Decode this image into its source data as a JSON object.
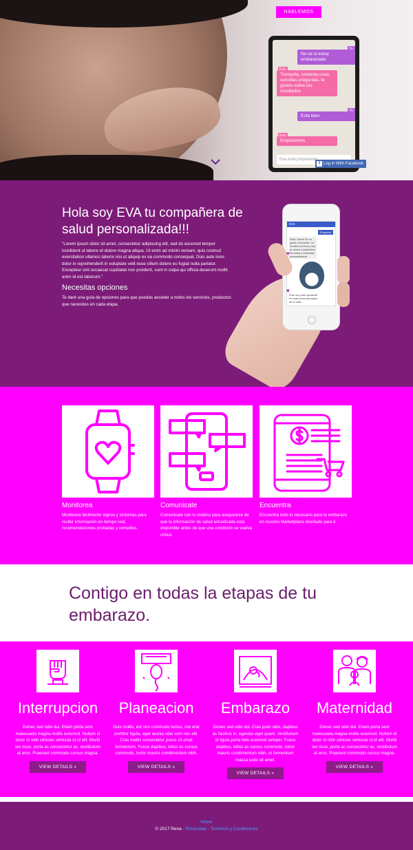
{
  "hero": {
    "cta_label": "HABLEMOS",
    "chat": {
      "messages": [
        {
          "who": "Yo:",
          "text": "No se si estoy embarazada"
        },
        {
          "who": "Eva:",
          "text": "Tranquila, contesta unas sencillas preguntas, te guiare sobre tus resultados"
        },
        {
          "who": "Yo:",
          "text": "Esta bien"
        },
        {
          "who": "Eva:",
          "text": "Empecemos"
        }
      ],
      "input_placeholder": "Eva está preparando...",
      "fb_label": "Log in With Facebook"
    }
  },
  "intro": {
    "title": "Hola soy EVA tu compañera de salud personalizada!!!",
    "lorem": "\"Lorem ipsum dolor sit amet, consectetur adipiscing elit, sed do eiusmod tempor incididunt ut labore et dolore magna aliqua. Ut enim ad minim veniam, quis nostrud exercitation ullamco laboris nisi ut aliquip ex ea commodo consequat. Duis aute irure dolor in reprehenderit in voluptate velit esse cillum dolore eu fugiat nulla pariatur. Excepteur sint occaecat cupidatat non proident, sunt in culpa qui officia deserunt mollit anim id est laborum.\"",
    "subtitle": "Necesitas opciones",
    "options_text": "Te daré una guía de opciones para que puedas acceder a todos los servicios, productos que necesites en cada etapa.",
    "phone": {
      "app_name": "EVA",
      "bubble1": "Empezar",
      "bubble2": "Hola, Karla! Es un gusto conocerla, mi nombre es Eva y soy tu nueva compañera de salud y bienestar personalizada.",
      "bubble3": "Esto soy para ayudarte en esta hermosa etapa de tu vida..."
    }
  },
  "features": [
    {
      "title": "Monitorea",
      "text": "Monitorea fácilmente signos y síntomas para recibir información en tiempo real, recomendaciones probadas y remedios.",
      "icon": "smartwatch-heart-icon"
    },
    {
      "title": "Comunicate",
      "text": "Comunicate con tu médico para asegurarse de que la información de salud actualizada está disponible antes de que una condición se vuelva crítica",
      "icon": "phone-chat-icon"
    },
    {
      "title": "Encuentra",
      "text": "Encuentra todo lo necesario para tu embarazo en nuestro Marketplace diseñado para ti.",
      "icon": "tablet-cart-icon"
    }
  ],
  "contigo": {
    "title": "Contigo en todas la etapas de tu embarazo."
  },
  "stages": [
    {
      "title": "Interrupcion",
      "text": "Donec sed odio dui. Etiam porta sem malesuada magna mollis euismod. Nullam id dolor id nibh ultricies vehicula ut id elit. Morbi leo risus, porta ac consectetur ac, vestibulum at eros. Praesent commodo cursus magna.",
      "button": "VIEW DETAILS »",
      "icon": "raised-fist-icon"
    },
    {
      "title": "Planeacion",
      "text": "Duis mollis, est non commodo luctus, nisi erat porttitor ligula, eget lacinia odio sem nec elit. Cras mattis consectetur purus sit amet fermentum. Fusce dapibus, tellus ac cursus commodo, tortor mauris condimentum nibh.",
      "button": "VIEW DETAILS »",
      "icon": "calendar-balloon-icon"
    },
    {
      "title": "Embarazo",
      "text": "Donec sed odio dui. Cras justo odio, dapibus ac facilisis in, egestas eget quam. Vestibulum id ligula porta felis euismod semper. Fusce dapibus, tellus ac cursus commodo, tortor mauris condimentum nibh, ut fermentum massa justo sit amet.",
      "button": "VIEW DETAILS »",
      "icon": "ultrasound-icon"
    },
    {
      "title": "Maternidad",
      "text": "Donec sed odio dui. Etiam porta sem malesuada magna mollis euismod. Nullam id dolor id nibh ultricies vehicula ut id elit. Morbi leo risus, porta ac consectetur ac, vestibulum at eros. Praesent commodo cursus magna.",
      "button": "VIEW DETAILS »",
      "icon": "family-icon"
    }
  ],
  "footer": {
    "volver": "Volver",
    "copyright": "© 2017 Rena · ",
    "privacy": "Privacidad",
    "sep": " · ",
    "terms": "Terminos y Condiciones"
  },
  "colors": {
    "magenta": "#ff00ff",
    "purple": "#7d1b79",
    "button_purple": "#8d1b8a",
    "dark_title": "#6b1d6b"
  }
}
